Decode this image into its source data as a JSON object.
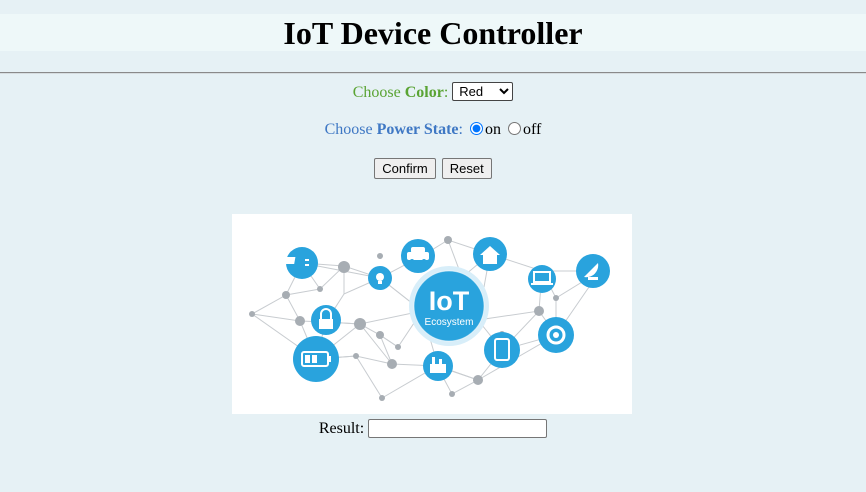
{
  "header": {
    "title": "IoT Device Controller"
  },
  "color_control": {
    "label_prefix": "Choose ",
    "label_bold": "Color",
    "label_suffix": ":",
    "selected": "Red",
    "options": [
      "Red"
    ]
  },
  "power_control": {
    "label_prefix": "Choose ",
    "label_bold": "Power State",
    "label_suffix": ":",
    "on_label": "on",
    "off_label": "off",
    "selected": "on"
  },
  "buttons": {
    "confirm_label": "Confirm",
    "reset_label": "Reset"
  },
  "image": {
    "center_title": "IoT",
    "center_subtitle": "Ecosystem"
  },
  "result": {
    "label": "Result:",
    "value": ""
  },
  "colors": {
    "page_background": "#e6f1f5",
    "color_label": "#5aa434",
    "power_label": "#3f78c4",
    "iot_blue": "#29a3dd"
  }
}
